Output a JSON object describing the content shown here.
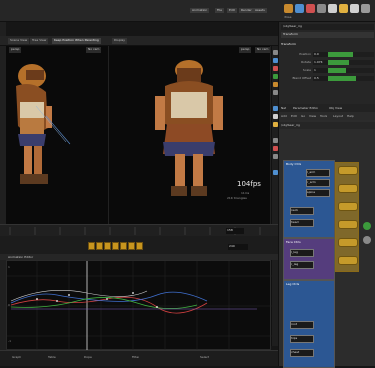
{
  "menubar": {
    "desk_label": "Animation",
    "menus": [
      "File",
      "Edit",
      "Render",
      "Assets",
      "Help"
    ],
    "shelf_tools": [
      {
        "label": "Pose",
        "color": "#c88a2e"
      },
      {
        "label": "Path",
        "color": "#4f8fd0"
      },
      {
        "label": "Keys",
        "color": "#d05050"
      },
      {
        "label": "Mask",
        "color": "#8a8a8a"
      },
      {
        "label": "Tangents",
        "color": "#cfcfcf"
      },
      {
        "label": "Stack",
        "color": "#e0b040"
      },
      {
        "label": "Flip",
        "color": "#d0d0d0"
      },
      {
        "label": "Ghost",
        "color": "#9a9a9a"
      }
    ]
  },
  "viewport_tabs": {
    "tabs": [
      "Scene View",
      "Tree View",
      "Keep Position When Parenting",
      "Display"
    ],
    "active": "Keep Position When Parenting"
  },
  "viewports": {
    "left": {
      "camera": "persp",
      "display": "No cam"
    },
    "right": {
      "camera": "persp",
      "display": "No cam",
      "fps": "104fps",
      "stats": "11ms",
      "info": "21K triangles"
    }
  },
  "timeline": {
    "frame": "158",
    "start": "1",
    "end": "240",
    "labels": [
      "1",
      "24",
      "48",
      "72",
      "96",
      "120",
      "144",
      "168",
      "192",
      "216",
      "240"
    ]
  },
  "graph_editor": {
    "header": "Animation Editor",
    "y_labels": [
      "1",
      "0",
      "-1"
    ],
    "x_labels": [
      "24",
      "48",
      "72",
      "96",
      "120",
      "144",
      "168",
      "192"
    ],
    "bottom_items": [
      "Graph",
      "Table",
      "Dope",
      "Filter",
      "Select"
    ]
  },
  "parameters": {
    "path": "/obj/bear_rig",
    "node": "Transform",
    "tab": "Transform",
    "rows": [
      {
        "label": "Position",
        "value": "0.0",
        "fill": 0.55
      },
      {
        "label": "Rotate",
        "value": "1.074",
        "fill": 0.45
      },
      {
        "label": "Scale",
        "value": "1",
        "fill": 0.4
      },
      {
        "label": "Blend Offset",
        "value": "0.5",
        "fill": 0.6
      }
    ]
  },
  "network": {
    "tabs": [
      "Net",
      "Parameter Editor",
      "Obj View"
    ],
    "menus": [
      "Add",
      "Edit",
      "Go",
      "View",
      "Tools",
      "Layout",
      "Help"
    ],
    "path": "/obj/bear_rig",
    "boxes": [
      {
        "label": "Body Ctrls",
        "color": "#2d5fa6"
      },
      {
        "label": "Face Ctrls",
        "color": "#5a3f86"
      },
      {
        "label": "Leg Ctrls",
        "color": "#2d5fa6"
      }
    ],
    "nodes": [
      "l_arm",
      "r_arm",
      "spine",
      "neck",
      "head",
      "l_leg",
      "r_leg",
      "root",
      "hips",
      "chest"
    ]
  }
}
